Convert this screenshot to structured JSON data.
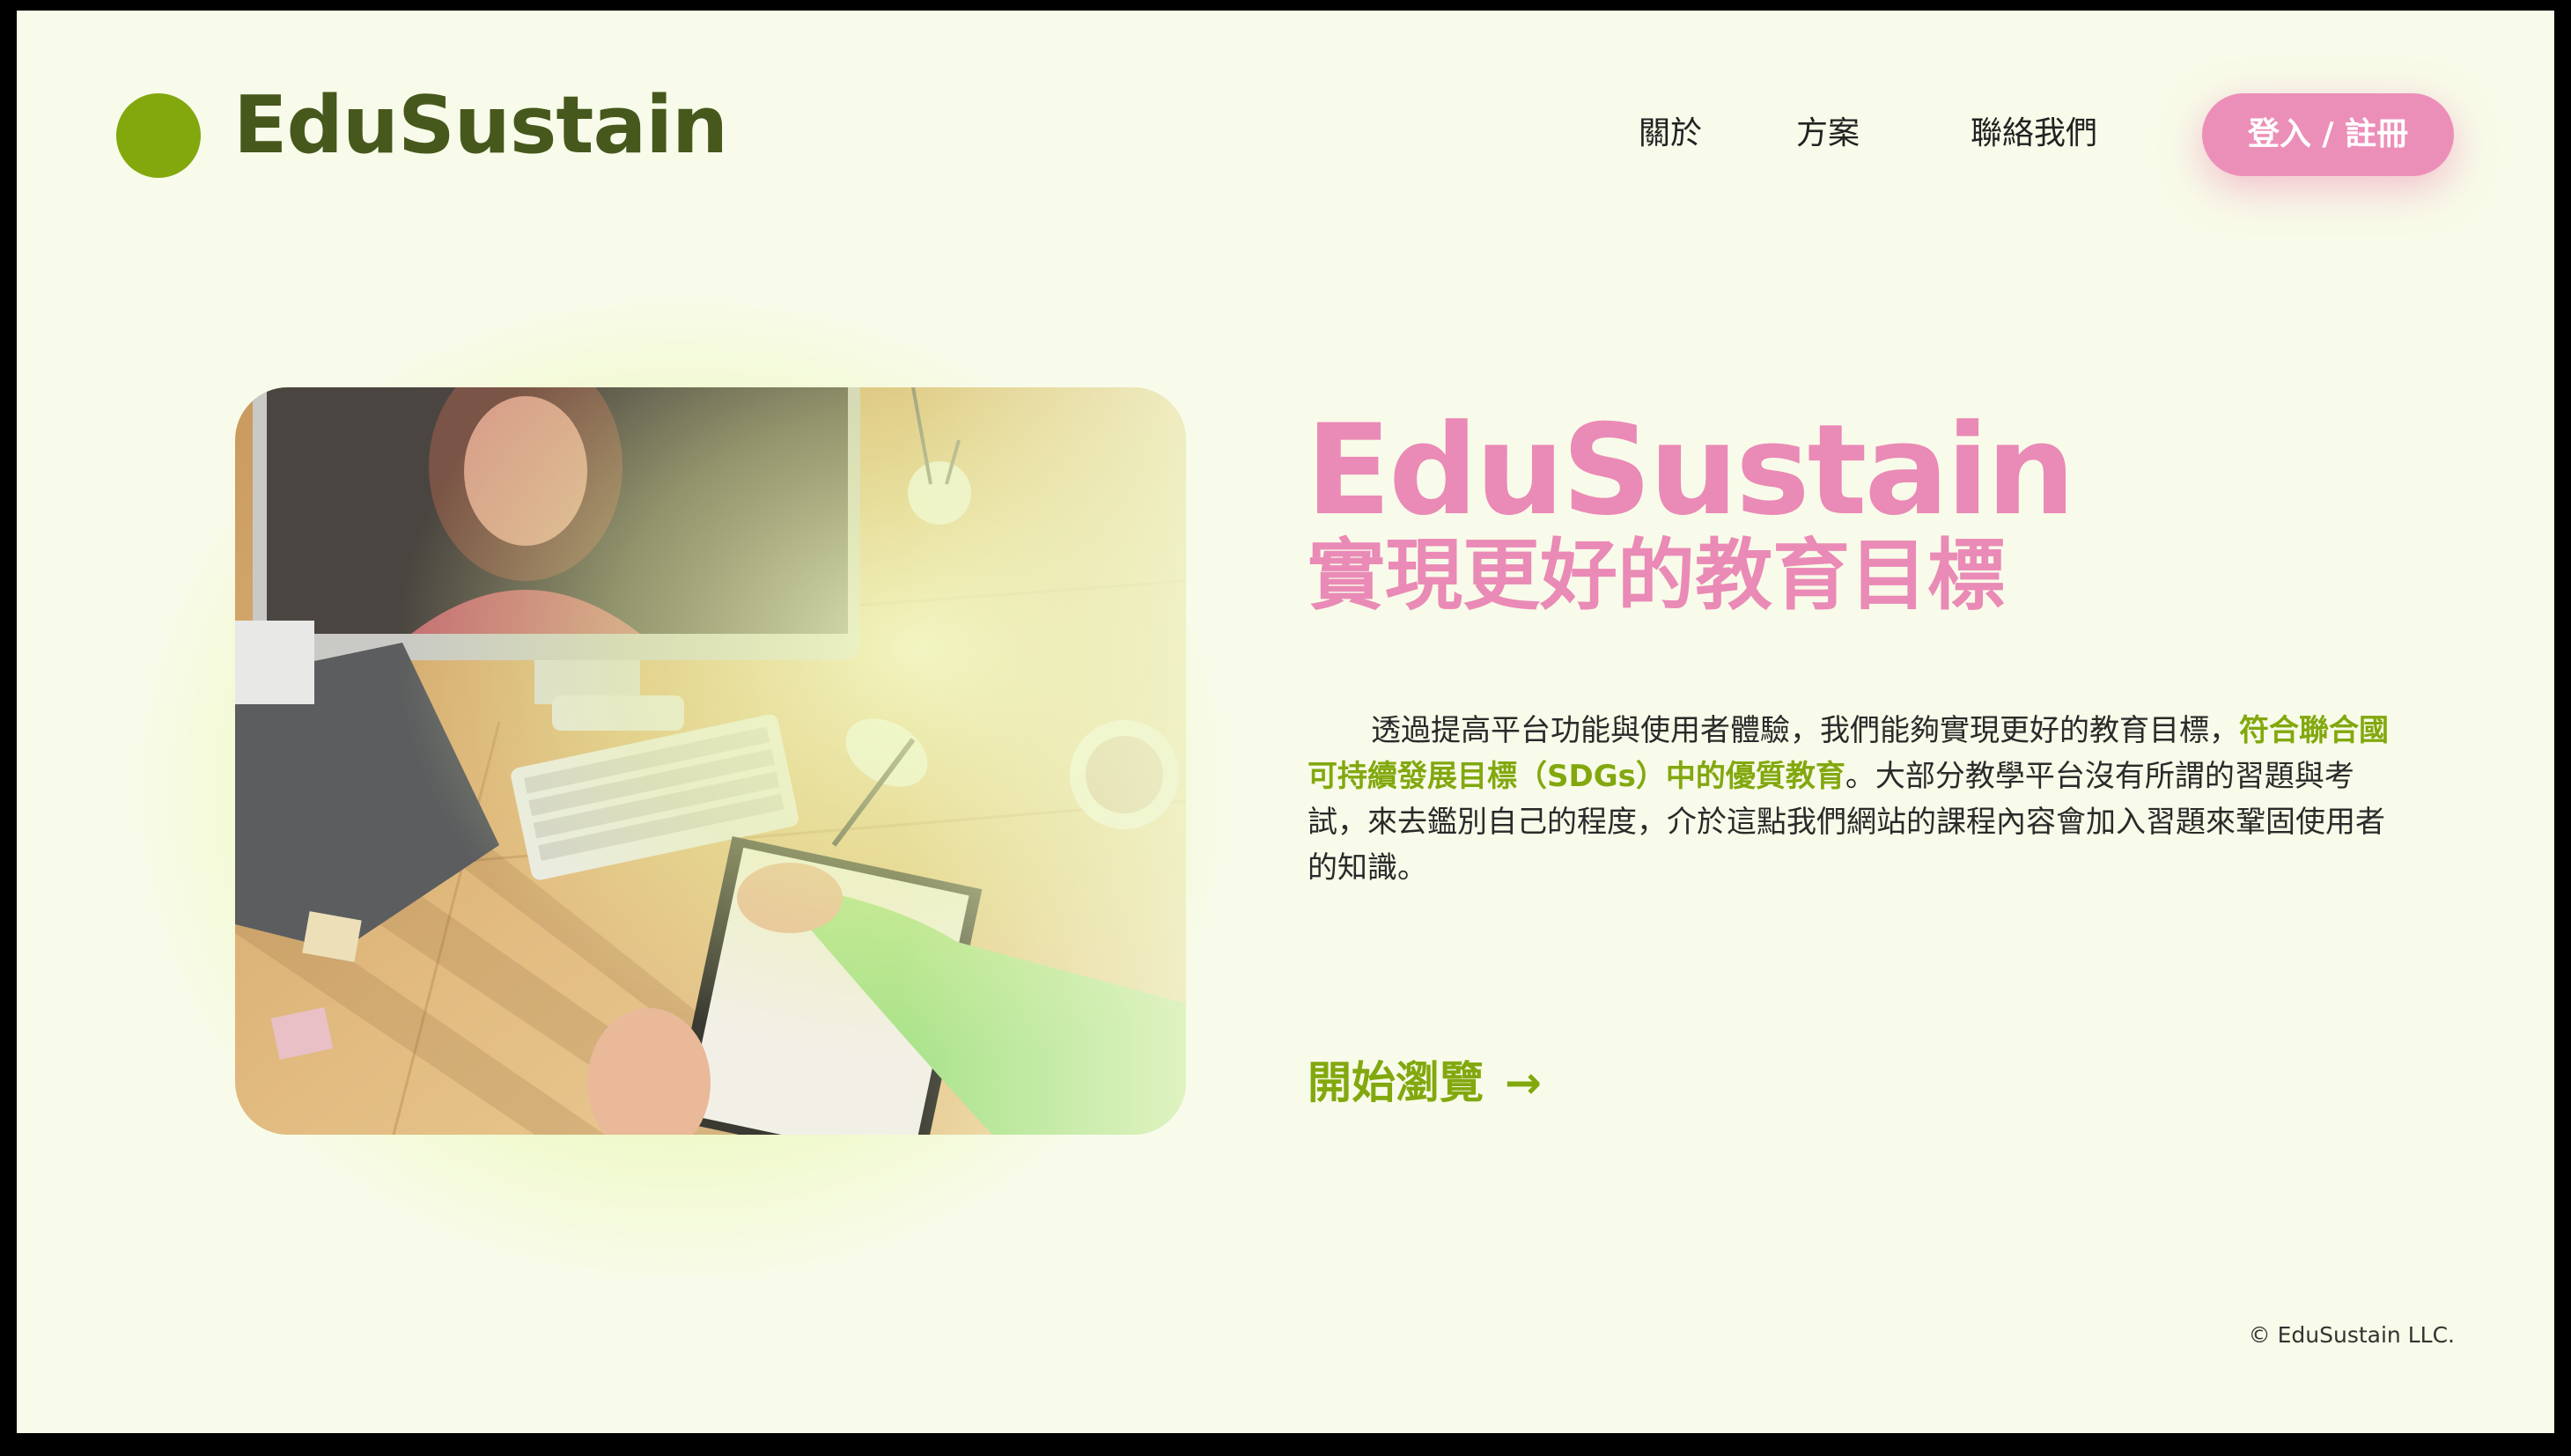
{
  "header": {
    "logo_text": "EduSustain",
    "nav": {
      "about": "關於",
      "plans": "方案",
      "contact": "聯絡我們"
    },
    "login_label": "登入 / 註冊"
  },
  "hero": {
    "title": "EduSustain",
    "subtitle": "實現更好的教育目標",
    "desc_part1": "透過提高平台功能與使用者體驗，我們能夠實現更好的教育目標，",
    "desc_highlight": "符合聯合國可持續發展目標（SDGs）中的優質教育",
    "desc_part2": "。大部分教學平台沒有所謂的習題與考試，來去鑑別自己的程度，介於這點我們網站的課程內容會加入習題來鞏固使用者的知識。",
    "browse_label": "開始瀏覽",
    "browse_arrow": "→"
  },
  "footer": {
    "copyright": "© EduSustain LLC."
  },
  "icons": {
    "logo": "green-circle",
    "browse": "arrow-right-icon"
  },
  "colors": {
    "background": "#f8fbe9",
    "accent_green": "#82a80e",
    "logo_text": "#46581c",
    "accent_pink": "#ec8fb8"
  }
}
